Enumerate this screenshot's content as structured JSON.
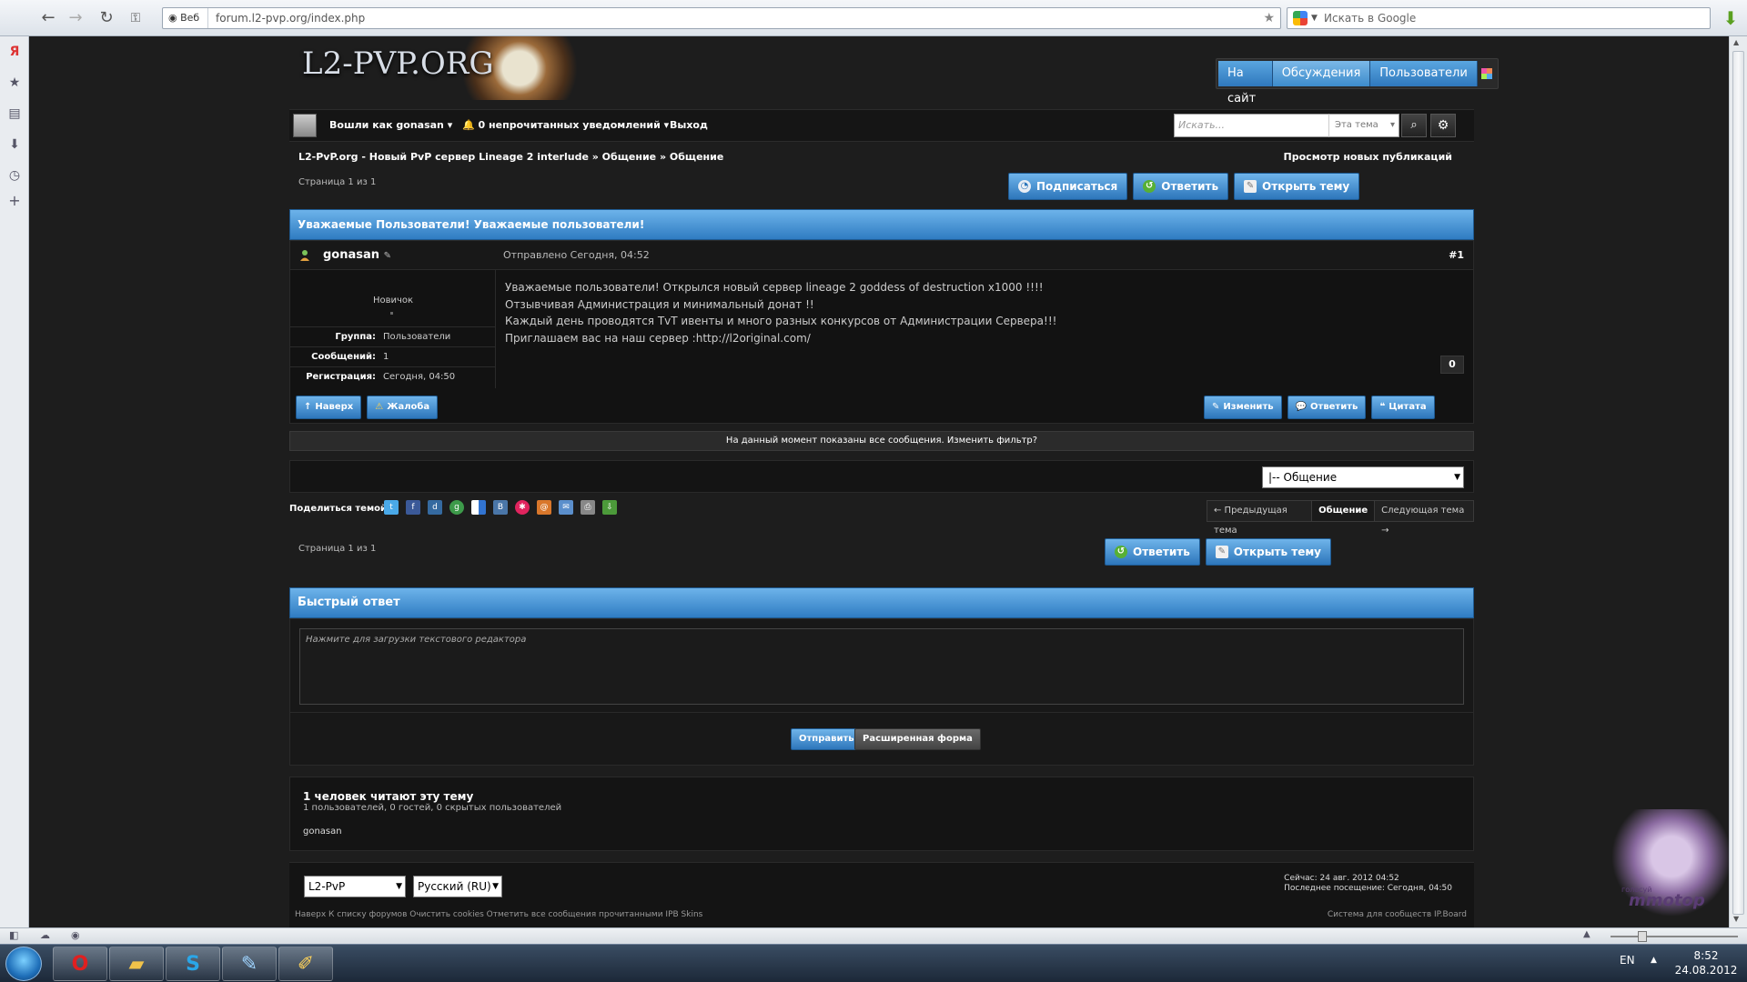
{
  "browser": {
    "web_label": "Веб",
    "url": "forum.l2-pvp.org/index.php",
    "search_placeholder": "Искать в Google"
  },
  "site": {
    "logo_text": "L2-PVP.ORG",
    "nav": [
      "На сайт",
      "Обсуждения",
      "Пользователи"
    ],
    "active_nav": "Обсуждения"
  },
  "userbar": {
    "logged_in_as": "Вошли как gonasan",
    "notif_count": "0",
    "notifications": "непрочитанных уведомлений",
    "logout": "Выход",
    "search_placeholder": "Искать...",
    "search_scope": "Эта тема"
  },
  "breadcrumb": {
    "items": [
      "L2-PvP.org - Новый PvP сервер Lineage 2 interlude",
      "» Общение",
      "» Общение"
    ],
    "new_posts": "Просмотр новых публикаций"
  },
  "pager": "Страница 1 из 1",
  "buttons": {
    "subscribe": "Подписаться",
    "reply": "Ответить",
    "new_topic": "Открыть тему"
  },
  "topic_title": "Уважаемые Пользователи! Уважаемые пользователи!",
  "post": {
    "author": "gonasan",
    "time": "Отправлено Сегодня, 04:52",
    "number": "#1",
    "rank": "Новичок",
    "info": [
      {
        "key": "Группа:",
        "value": "Пользователи"
      },
      {
        "key": "Сообщений:",
        "value": "1"
      },
      {
        "key": "Регистрация:",
        "value": "Сегодня, 04:50"
      }
    ],
    "body": [
      "Уважаемые пользователи! Открылся новый сервер lineage 2 goddess of destruction x1000 !!!!",
      "Отзывчивая Администрация и минимальный донат !!",
      "Каждый день проводятся TvT ивенты и много разных конкурсов от Администрации Сервера!!!",
      "Приглашаем вас на наш сервер :http://l2original.com/"
    ],
    "reputation": "0",
    "actions_left": [
      "Наверх",
      "Жалоба"
    ],
    "actions_right": [
      "Изменить",
      "Ответить",
      "Цитата"
    ]
  },
  "filter_text": "На данный момент показаны все сообщения. Изменить фильтр?",
  "jump_select": "|-- Общение",
  "share": {
    "label": "Поделиться темой:",
    "icons": [
      "twitter-icon",
      "facebook-icon",
      "digg-icon",
      "google-icon",
      "delicious-icon",
      "vkontakte-icon",
      "livejournal-icon",
      "mailru-icon",
      "email-icon",
      "print-icon",
      "download-icon"
    ]
  },
  "topic_nav": {
    "prev": "← Предыдущая тема",
    "current": "Общение",
    "next": "Следующая тема →"
  },
  "quick_reply": {
    "title": "Быстрый ответ",
    "placeholder": "Нажмите для загрузки текстового редактора",
    "send": "Отправить",
    "advanced": "Расширенная форма"
  },
  "readers": {
    "title": "1 человек читают эту тему",
    "subtitle": "1 пользователей, 0 гостей, 0 скрытых пользователей",
    "names": "gonasan"
  },
  "footer": {
    "skin_select": "L2-PvP",
    "lang_select": "Русский (RU)",
    "now": "Сейчас: 24 авг. 2012 04:52",
    "last_visit": "Последнее посещение: Сегодня, 04:50",
    "links": "Наверх   К списку форумов   Очистить cookies   Отметить все сообщения прочитанными   IPB Skins",
    "copyright": "Система для сообществ IP.Board"
  },
  "taskbar": {
    "lang": "EN",
    "time": "8:52",
    "date": "24.08.2012"
  },
  "ads": {
    "vote": "голосуй",
    "brand": "mmotop"
  }
}
